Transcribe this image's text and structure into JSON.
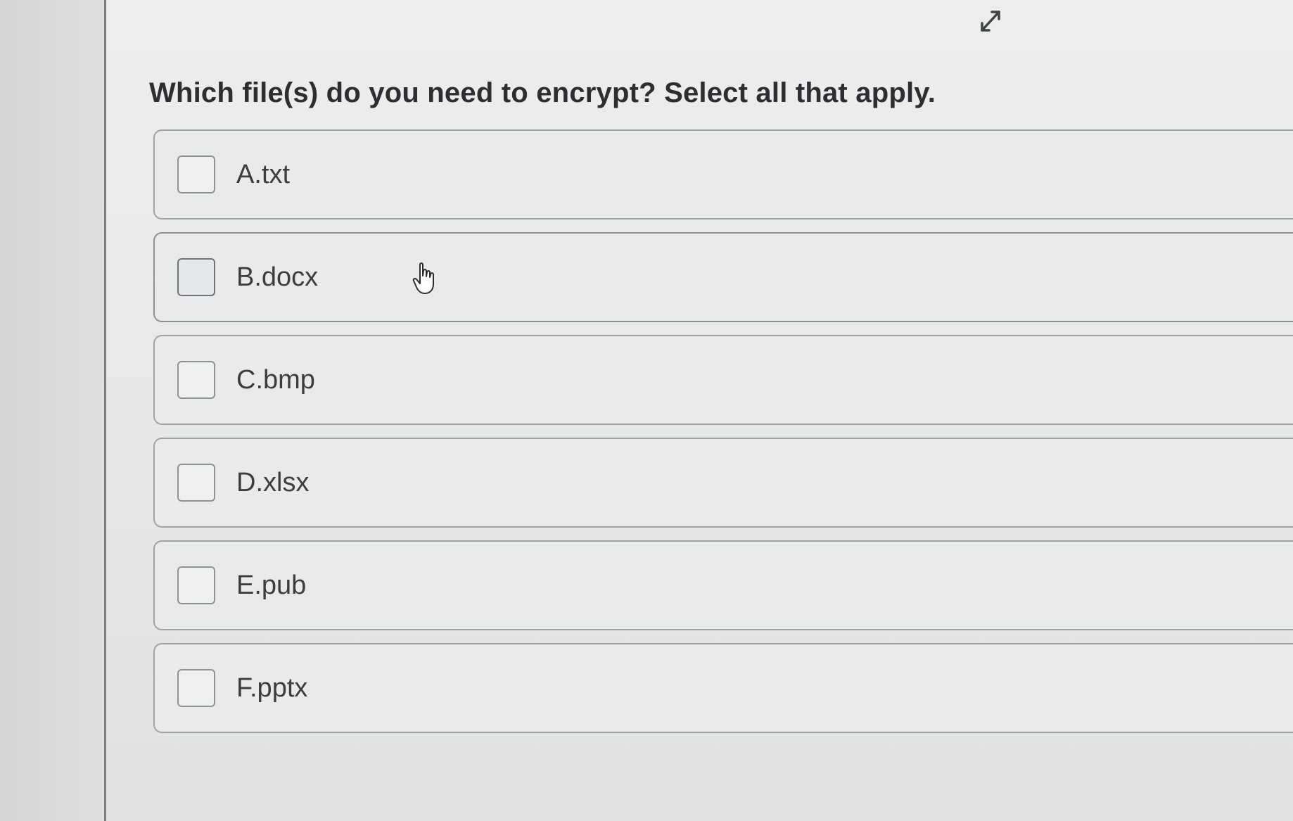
{
  "question": {
    "text": "Which file(s) do you need to encrypt? Select all that apply."
  },
  "expand_icon": "expand-arrows-icon",
  "options": [
    {
      "label": "A.txt",
      "checked": false
    },
    {
      "label": "B.docx",
      "checked": false
    },
    {
      "label": "C.bmp",
      "checked": false
    },
    {
      "label": "D.xlsx",
      "checked": false
    },
    {
      "label": "E.pub",
      "checked": false
    },
    {
      "label": "F.pptx",
      "checked": false
    }
  ],
  "cursor_icon": "hand-pointer-icon",
  "colors": {
    "text": "#2b2f31",
    "option_border": "#9ea3a3",
    "panel_border": "#7c8080"
  }
}
